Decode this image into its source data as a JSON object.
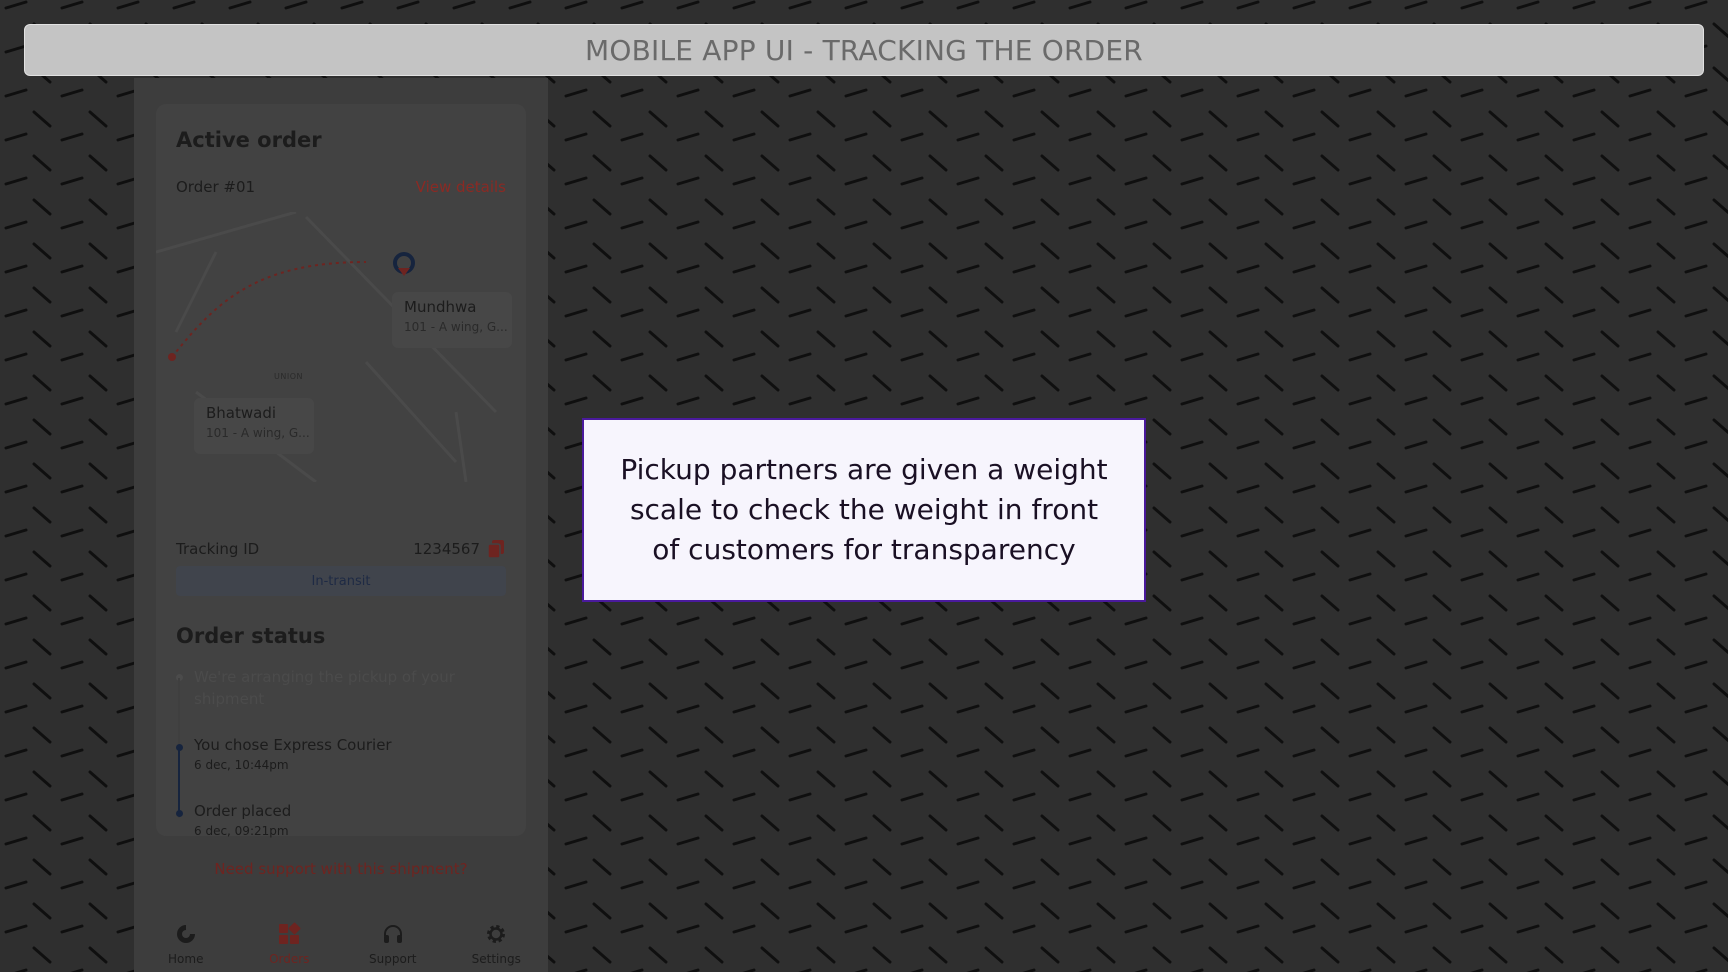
{
  "slide": {
    "title": "MOBILE APP UI - TRACKING THE ORDER"
  },
  "order_card": {
    "heading": "Active order",
    "order_number": "Order #01",
    "view_details_label": "View details",
    "map": {
      "destination": {
        "name": "Mundhwa",
        "address": "101 - A wing, G..."
      },
      "origin": {
        "name": "Bhatwadi",
        "address": "101 - A wing, G..."
      },
      "area_label": "UNION"
    },
    "tracking": {
      "label": "Tracking ID",
      "id": "1234567",
      "status": "In-transit"
    }
  },
  "order_status": {
    "heading": "Order status",
    "steps": [
      {
        "text": "We're arranging the pickup of your shipment",
        "time": ""
      },
      {
        "text": "You chose Express Courier",
        "time": "6 dec, 10:44pm"
      },
      {
        "text": "Order placed",
        "time": "6 dec, 09:21pm"
      }
    ]
  },
  "support_link": "Need support with this shipment?",
  "bottom_nav": {
    "items": [
      {
        "label": "Home",
        "icon": "home-icon"
      },
      {
        "label": "Orders",
        "icon": "orders-icon"
      },
      {
        "label": "Support",
        "icon": "headset-icon"
      },
      {
        "label": "Settings",
        "icon": "gear-icon"
      }
    ],
    "active": "Orders"
  },
  "callout": {
    "text": "Pickup partners are given a weight scale to check the weight in front of customers for transparency"
  },
  "colors": {
    "accent": "#6e2420",
    "callout_border": "#4a1a9c",
    "background": "#2f2f2f"
  }
}
